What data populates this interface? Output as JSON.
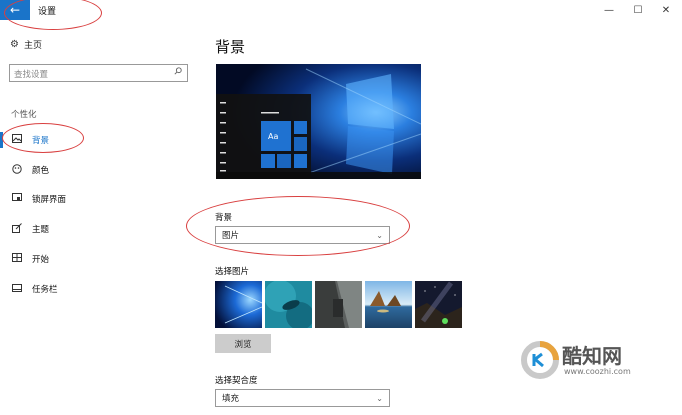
{
  "window": {
    "title": "设置",
    "back_icon": "←",
    "minimize_icon": "—",
    "maximize_icon": "☐",
    "close_icon": "✕"
  },
  "sidebar": {
    "home_label": "主页",
    "search_placeholder": "查找设置",
    "section_label": "个性化",
    "items": [
      {
        "label": "背景",
        "icon": "image-icon",
        "active": true
      },
      {
        "label": "颜色",
        "icon": "palette-icon",
        "active": false
      },
      {
        "label": "锁屏界面",
        "icon": "lock-screen-icon",
        "active": false
      },
      {
        "label": "主题",
        "icon": "theme-icon",
        "active": false
      },
      {
        "label": "开始",
        "icon": "start-icon",
        "active": false
      },
      {
        "label": "任务栏",
        "icon": "taskbar-icon",
        "active": false
      }
    ]
  },
  "main": {
    "page_title": "背景",
    "preview_tile_label": "Aa",
    "background_label": "背景",
    "background_value": "图片",
    "choose_picture_label": "选择图片",
    "browse_label": "浏览",
    "fit_label": "选择契合度",
    "fit_value": "填充"
  },
  "watermark": {
    "name": "酷知网",
    "url": "www.coozhi.com"
  },
  "colors": {
    "accent": "#1a74c9",
    "annotation": "#d94040"
  }
}
